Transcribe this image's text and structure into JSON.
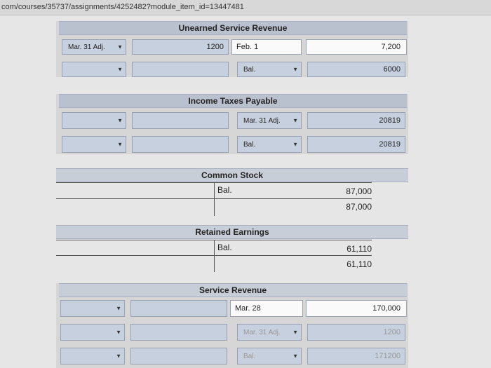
{
  "url": "com/courses/35737/assignments/4252482?module_item_id=13447481",
  "unearned": {
    "title": "Unearned Service Revenue",
    "r1_select": "Mar. 31 Adj.",
    "r1_amount": "1200",
    "r1_credit_label": "Feb. 1",
    "r1_credit_amount": "7,200",
    "r2_select": "",
    "r2_amount": "",
    "r2_credit_select": "Bal.",
    "r2_credit_amount": "6000"
  },
  "income_taxes": {
    "title": "Income Taxes Payable",
    "r1_select": "",
    "r1_amount": "",
    "r1_credit_select": "Mar. 31 Adj.",
    "r1_credit_amount": "20819",
    "r2_select": "",
    "r2_amount": "",
    "r2_credit_select": "Bal.",
    "r2_credit_amount": "20819"
  },
  "common_stock": {
    "title": "Common Stock",
    "credit_label": "Bal.",
    "credit_amount": "87,000",
    "balance": "87,000"
  },
  "retained_earnings": {
    "title": "Retained Earnings",
    "credit_label": "Bal.",
    "credit_amount": "61,110",
    "balance": "61,110"
  },
  "service_revenue": {
    "title": "Service Revenue",
    "r1_credit_label": "Mar. 28",
    "r1_credit_amount": "170,000",
    "r2_credit_select": "Mar. 31 Adj.",
    "r2_credit_amount": "1200",
    "r3_credit_select": "Bal.",
    "r3_credit_amount": "171200"
  },
  "icons": {
    "dropdown": "▼"
  }
}
